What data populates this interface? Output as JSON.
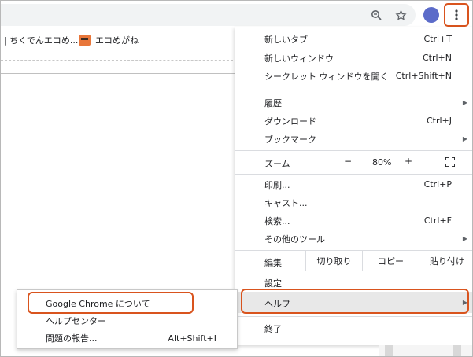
{
  "toolbar": {
    "icons": [
      "zoom-icon",
      "star-icon",
      "avatar",
      "more-vert-icon"
    ]
  },
  "bookmarks": {
    "items": [
      {
        "label": "| ちくでんエコめ..."
      },
      {
        "label": "エコめがね"
      }
    ]
  },
  "menu": {
    "new_tab": {
      "label": "新しいタブ",
      "shortcut": "Ctrl+T"
    },
    "new_window": {
      "label": "新しいウィンドウ",
      "shortcut": "Ctrl+N"
    },
    "incognito": {
      "label": "シークレット ウィンドウを開く",
      "shortcut": "Ctrl+Shift+N"
    },
    "history": {
      "label": "履歴"
    },
    "downloads": {
      "label": "ダウンロード",
      "shortcut": "Ctrl+J"
    },
    "bookmarks": {
      "label": "ブックマーク"
    },
    "zoom": {
      "label": "ズーム",
      "minus": "−",
      "value": "80%",
      "plus": "+"
    },
    "print": {
      "label": "印刷...",
      "shortcut": "Ctrl+P"
    },
    "cast": {
      "label": "キャスト..."
    },
    "find": {
      "label": "検索...",
      "shortcut": "Ctrl+F"
    },
    "more_tools": {
      "label": "その他のツール"
    },
    "edit": {
      "label": "編集",
      "cut": "切り取り",
      "copy": "コピー",
      "paste": "貼り付け"
    },
    "settings": {
      "label": "設定"
    },
    "help": {
      "label": "ヘルプ"
    },
    "exit": {
      "label": "終了"
    }
  },
  "submenu": {
    "about": {
      "label": "Google Chrome について"
    },
    "help_center": {
      "label": "ヘルプセンター"
    },
    "report": {
      "label": "問題の報告...",
      "shortcut": "Alt+Shift+I"
    }
  },
  "colors": {
    "highlight": "#d9541e",
    "hover": "#e8e8e8",
    "avatar": "#5b6bc9"
  }
}
